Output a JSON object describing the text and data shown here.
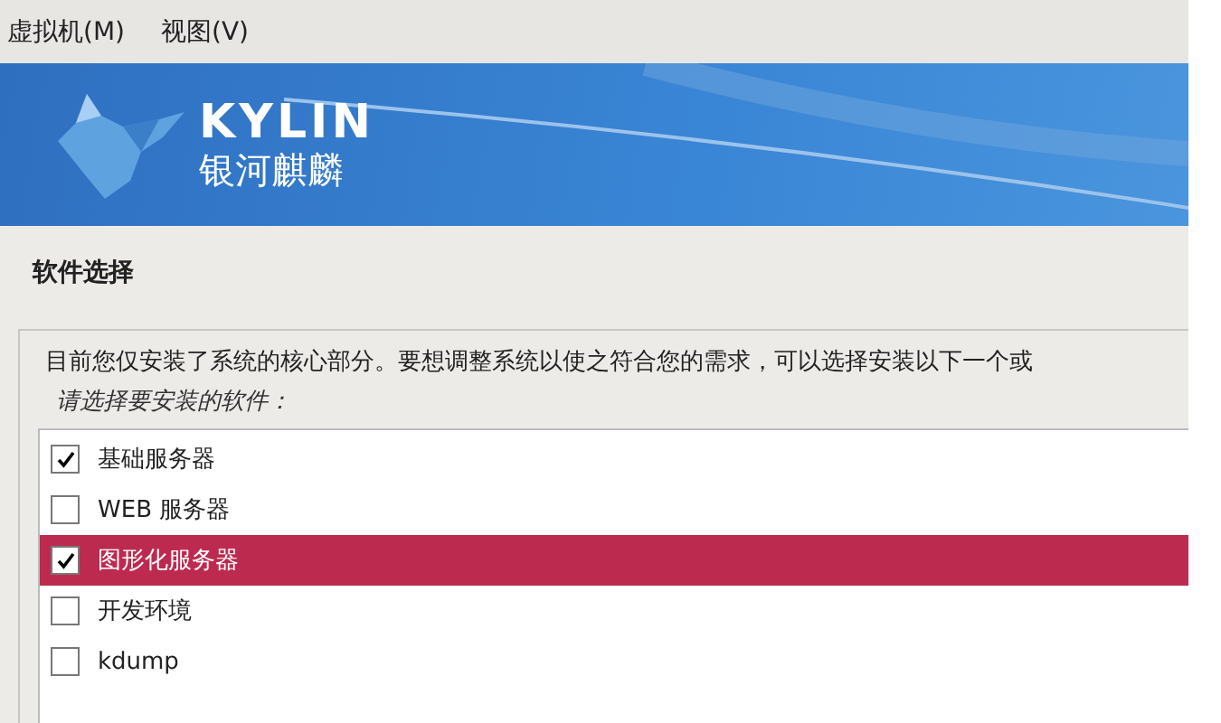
{
  "menu_bar": [
    {
      "label": "虚拟机(M)"
    },
    {
      "label": "视图(V)"
    }
  ],
  "banner": {
    "logo_title": "KYLIN",
    "logo_subtitle": "银河麒麟"
  },
  "section_title": "软件选择",
  "description": "目前您仅安装了系统的核心部分。要想调整系统以使之符合您的需求，可以选择安装以下一个或",
  "prompt": "请选择要安装的软件：",
  "software": [
    {
      "label": "基础服务器",
      "checked": true,
      "selected": false
    },
    {
      "label": "WEB 服务器",
      "checked": false,
      "selected": false
    },
    {
      "label": "图形化服务器",
      "checked": true,
      "selected": true
    },
    {
      "label": "开发环境",
      "checked": false,
      "selected": false
    },
    {
      "label": "kdump",
      "checked": false,
      "selected": false
    }
  ]
}
